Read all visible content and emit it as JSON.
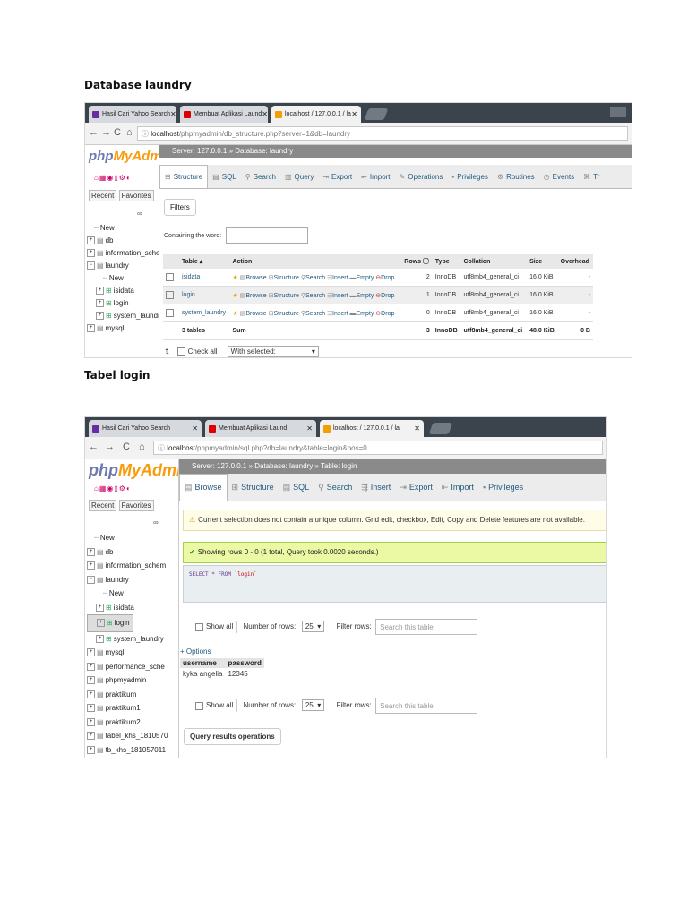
{
  "headings": {
    "first": "Database laundry",
    "second": "Tabel login"
  },
  "browser1": {
    "tabs": [
      "Hasil Cari Yahoo Search",
      "Membuat Aplikasi Laund",
      "localhost / 127.0.0.1 / la"
    ],
    "url_host": "localhost",
    "url_path": "/phpmyadmin/db_structure.php?server=1&db=laundry"
  },
  "browser2": {
    "tabs": [
      "Hasil Cari Yahoo Search",
      "Membuat Aplikasi Laund",
      "localhost / 127.0.0.1 / la"
    ],
    "url_host": "localhost",
    "url_path": "/phpmyadmin/sql.php?db=laundry&table=login&pos=0"
  },
  "pma": {
    "logo_a": "php",
    "logo_b": "MyAdmi",
    "recent": "Recent",
    "favorites": "Favorites"
  },
  "shot1": {
    "breadcrumb": "Server: 127.0.0.1 » Database: laundry",
    "tabs": [
      {
        "icon": "⊞",
        "label": "Structure"
      },
      {
        "icon": "▤",
        "label": "SQL"
      },
      {
        "icon": "⚲",
        "label": "Search"
      },
      {
        "icon": "▥",
        "label": "Query"
      },
      {
        "icon": "⇥",
        "label": "Export"
      },
      {
        "icon": "⇤",
        "label": "Import"
      },
      {
        "icon": "✎",
        "label": "Operations"
      },
      {
        "icon": "▪",
        "label": "Privileges"
      },
      {
        "icon": "⚙",
        "label": "Routines"
      },
      {
        "icon": "◷",
        "label": "Events"
      },
      {
        "icon": "⌘",
        "label": "Tr"
      }
    ],
    "tree": [
      "New",
      "db",
      "information_schem",
      "laundry",
      "New",
      "isidata",
      "login",
      "system_laundry",
      "mysql"
    ],
    "filters_label": "Filters",
    "containing_label": "Containing the word:",
    "columns": {
      "table": "Table",
      "action": "Action",
      "rows": "Rows",
      "type": "Type",
      "collation": "Collation",
      "size": "Size",
      "overhead": "Overhead"
    },
    "actions": {
      "browse": "Browse",
      "structure": "Structure",
      "search": "Search",
      "insert": "Insert",
      "empty": "Empty",
      "drop": "Drop"
    },
    "rows": [
      {
        "name": "isidata",
        "rows": "2",
        "type": "InnoDB",
        "collation": "utf8mb4_general_ci",
        "size": "16.0 KiB",
        "overhead": "-"
      },
      {
        "name": "login",
        "rows": "1",
        "type": "InnoDB",
        "collation": "utf8mb4_general_ci",
        "size": "16.0 KiB",
        "overhead": "-"
      },
      {
        "name": "system_laundry",
        "rows": "0",
        "type": "InnoDB",
        "collation": "utf8mb4_general_ci",
        "size": "16.0 KiB",
        "overhead": "-"
      }
    ],
    "sum": {
      "name": "3 tables",
      "label": "Sum",
      "rows": "3",
      "type": "InnoDB",
      "collation": "utf8mb4_general_ci",
      "size": "48.0 KiB",
      "overhead": "0 B"
    },
    "check_all": "Check all",
    "with_selected": "With selected:"
  },
  "shot2": {
    "breadcrumb": "Server: 127.0.0.1 » Database: laundry » Table: login",
    "tabs": [
      {
        "icon": "▤",
        "label": "Browse"
      },
      {
        "icon": "⊞",
        "label": "Structure"
      },
      {
        "icon": "▤",
        "label": "SQL"
      },
      {
        "icon": "⚲",
        "label": "Search"
      },
      {
        "icon": "⇶",
        "label": "Insert"
      },
      {
        "icon": "⇥",
        "label": "Export"
      },
      {
        "icon": "⇤",
        "label": "Import"
      },
      {
        "icon": "▪",
        "label": "Privileges"
      }
    ],
    "tree": [
      "New",
      "db",
      "information_schem",
      "laundry",
      "New",
      "isidata",
      "login",
      "system_laundry",
      "mysql",
      "performance_sche",
      "phpmyadmin",
      "praktikum",
      "praktikum1",
      "praktikum2",
      "tabel_khs_1810570",
      "tb_khs_181057011"
    ],
    "warning": "Current selection does not contain a unique column. Grid edit, checkbox, Edit, Copy and Delete features are not available.",
    "success": "Showing rows 0 - 0 (1 total, Query took 0.0020 seconds.)",
    "sql_kw": "SELECT * FROM",
    "sql_tbl": "`login`",
    "show_all": "Show all",
    "number_of_rows": "Number of rows:",
    "rows_value": "25",
    "filter_rows": "Filter rows:",
    "search_placeholder": "Search this table",
    "options": "+ Options",
    "columns": [
      "username",
      "password"
    ],
    "data_row": [
      "kyka angelia",
      "12345"
    ],
    "query_results": "Query results operations"
  }
}
